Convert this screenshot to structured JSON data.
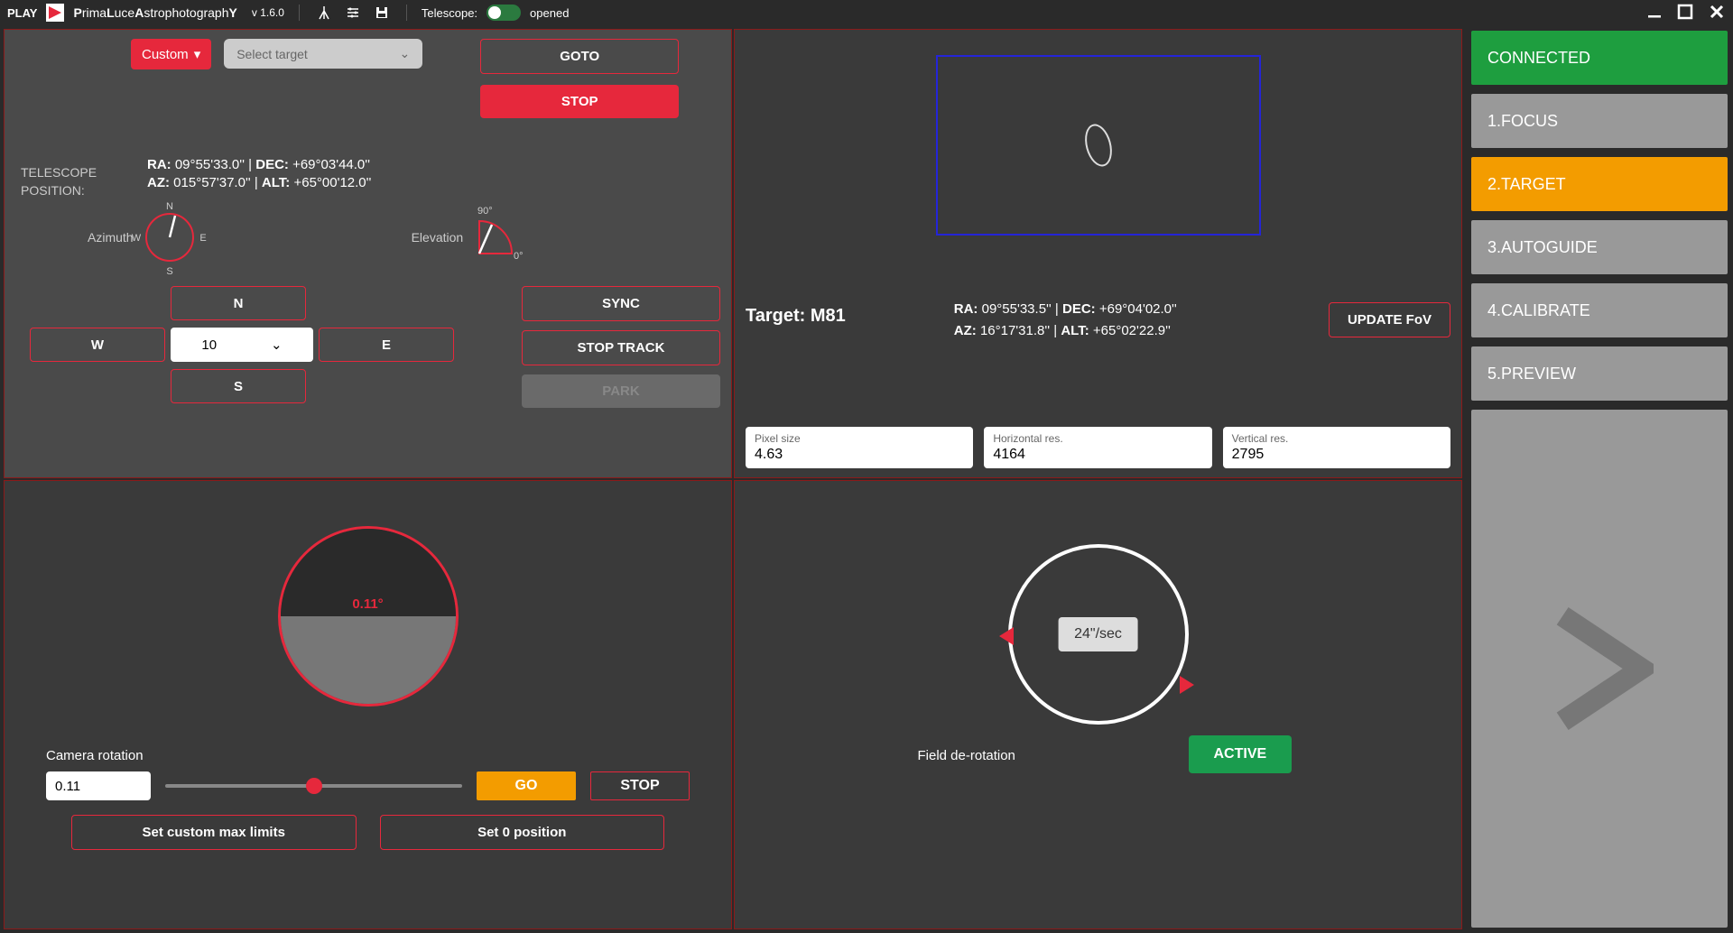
{
  "topbar": {
    "play": "PLAY",
    "app_name_prefix": "P",
    "app_name_middle1": "rima",
    "app_name_middle2": "L",
    "app_name_middle3": "uce",
    "app_name_middle4": "A",
    "app_name_middle5": "strophotograph",
    "app_name_suffix": "Y",
    "version": "v 1.6.0",
    "telescope_label": "Telescope:",
    "telescope_status": "opened"
  },
  "telescope_panel": {
    "custom": "Custom",
    "select_target": "Select target",
    "goto": "GOTO",
    "stop": "STOP",
    "position_label_line1": "TELESCOPE",
    "position_label_line2": "POSITION:",
    "ra_label": "RA:",
    "ra_val": "09°55'33.0''",
    "dec_label": "DEC:",
    "dec_val": "+69°03'44.0''",
    "az_label": "AZ:",
    "az_val": "015°57'37.0''",
    "alt_label": "ALT:",
    "alt_val": "+65°00'12.0''",
    "azimuth_label": "Azimuth",
    "elevation_label": "Elevation",
    "compass_n": "N",
    "compass_s": "S",
    "compass_e": "E",
    "compass_w": "W",
    "elev_90": "90°",
    "elev_0": "0°",
    "n_btn": "N",
    "s_btn": "S",
    "e_btn": "E",
    "w_btn": "W",
    "speed": "10",
    "sync": "SYNC",
    "stop_track": "STOP TRACK",
    "park": "PARK"
  },
  "target_panel": {
    "target_label": "Target: ",
    "target_name": "M81",
    "ra_label": "RA:",
    "ra_val": "09°55'33.5''",
    "dec_label": "DEC:",
    "dec_val": "+69°04'02.0''",
    "az_label": "AZ:",
    "az_val": "16°17'31.8''",
    "alt_label": "ALT:",
    "alt_val": "+65°02'22.9''",
    "update_fov": "UPDATE FoV",
    "pixel_size_label": "Pixel size",
    "pixel_size": "4.63",
    "hres_label": "Horizontal res.",
    "hres": "4164",
    "vres_label": "Vertical res.",
    "vres": "2795"
  },
  "rotator_panel": {
    "angle": "0.11°",
    "cam_rot_label": "Camera rotation",
    "angle_input": "0.11",
    "go": "GO",
    "stop": "STOP",
    "set_limits": "Set custom max limits",
    "set_zero": "Set 0 position"
  },
  "derotation_panel": {
    "speed": "24\"/sec",
    "label": "Field de-rotation",
    "active": "ACTIVE"
  },
  "rail": {
    "connected": "CONNECTED",
    "focus": "1.FOCUS",
    "target": "2.TARGET",
    "autoguide": "3.AUTOGUIDE",
    "calibrate": "4.CALIBRATE",
    "preview": "5.PREVIEW"
  }
}
